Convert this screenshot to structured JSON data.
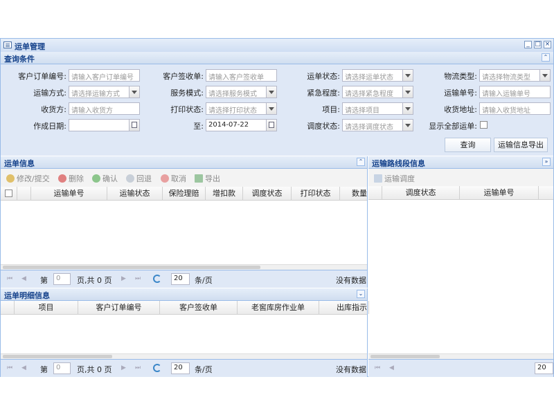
{
  "window": {
    "title": "运单管理"
  },
  "query": {
    "title": "查询条件",
    "row1": [
      {
        "label": "客户订单编号:",
        "placeholder": "请输入客户订单编号"
      },
      {
        "label": "客户签收单:",
        "placeholder": "请输入客户签收单"
      },
      {
        "label": "运单状态:",
        "placeholder": "请选择运单状态"
      },
      {
        "label": "物流类型:",
        "placeholder": "请选择物流类型"
      }
    ],
    "row2": [
      {
        "label": "运输方式:",
        "placeholder": "请选择运输方式"
      },
      {
        "label": "服务模式:",
        "placeholder": "请选择服务模式"
      },
      {
        "label": "紧急程度:",
        "placeholder": "请选择紧急程度"
      },
      {
        "label": "运输单号:",
        "placeholder": "请输入运输单号"
      }
    ],
    "row3": [
      {
        "label": "收货方:",
        "placeholder": "请输入收货方"
      },
      {
        "label": "打印状态:",
        "placeholder": "请选择打印状态"
      },
      {
        "label": "项目:",
        "placeholder": "请选择项目"
      },
      {
        "label": "收货地址:",
        "placeholder": "请输入收货地址"
      }
    ],
    "row4": {
      "date_from_label": "作成日期:",
      "date_to_label": "至:",
      "date_to_value": "2014-07-22",
      "dispatch_label": "调度状态:",
      "dispatch_placeholder": "请选择调度状态",
      "show_all_label": "显示全部运单:"
    },
    "search_button": "查询",
    "export_button": "运输信息导出"
  },
  "waybill": {
    "title": "运单信息",
    "toolbar": [
      "修改/提交",
      "删除",
      "确认",
      "回退",
      "取消",
      "导出"
    ],
    "columns": [
      "运输单号",
      "运输状态",
      "保险理赔",
      "增扣款",
      "调度状态",
      "打印状态",
      "数量"
    ],
    "pager": {
      "page_label": "第",
      "page_value": "0",
      "of_label": "页,共 0 页",
      "size": "20",
      "size_label": "条/页",
      "status": "没有数据"
    }
  },
  "detail": {
    "title": "运单明细信息",
    "columns": [
      "项目",
      "客户订单编号",
      "客户签收单",
      "老窖库房作业单",
      "出库指示"
    ],
    "pager": {
      "page_label": "第",
      "page_value": "0",
      "of_label": "页,共 0 页",
      "size": "20",
      "size_label": "条/页",
      "status": "没有数据"
    }
  },
  "route": {
    "title": "运输路线段信息",
    "toolbar_label": "运输调度",
    "columns": [
      "调度状态",
      "运输单号"
    ],
    "pager": {
      "size": "20"
    }
  },
  "colors": {
    "header_text": "#15428b",
    "border": "#99bbe8",
    "panel_bg": "#dfe8f6"
  }
}
